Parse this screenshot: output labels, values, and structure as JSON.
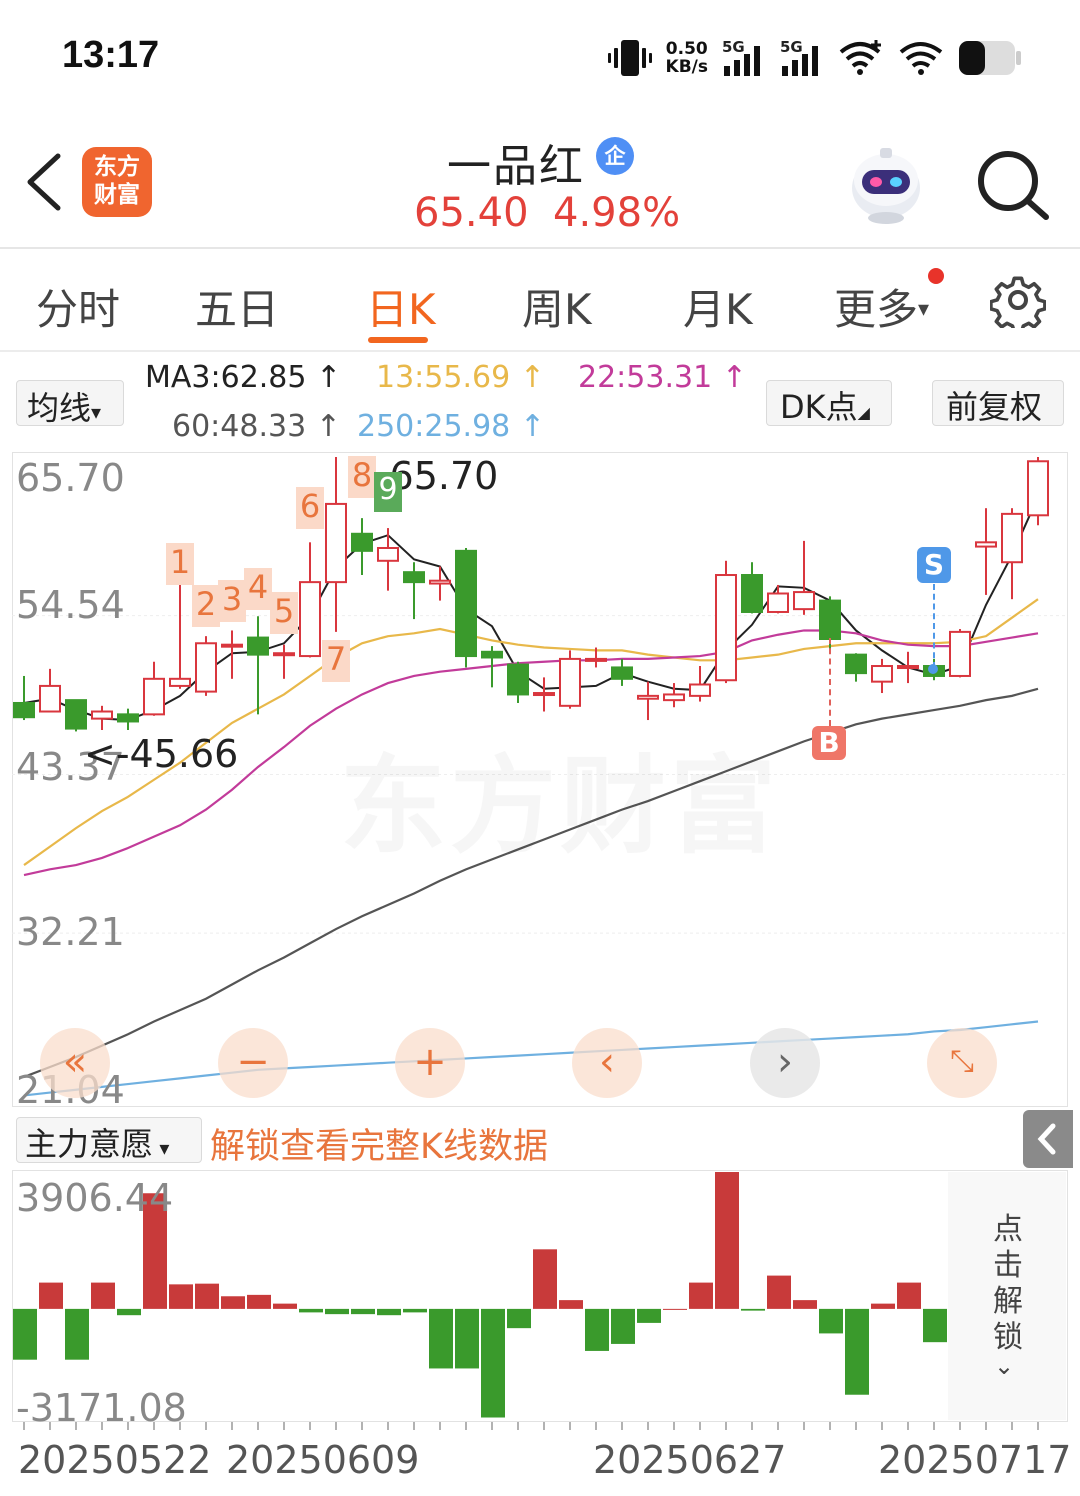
{
  "status_bar": {
    "time": "13:17",
    "net_speed_value": "0.50",
    "net_speed_unit": "KB/s",
    "sim1_label": "5G",
    "sim2_label": "5G",
    "icons": [
      "vibrate-icon",
      "signal-icon",
      "signal-icon",
      "wifi-plus-icon",
      "wifi-icon",
      "battery-icon"
    ],
    "battery_level": 0.35
  },
  "header": {
    "app_logo_line1": "东方",
    "app_logo_line2": "财富",
    "stock_name": "一品红",
    "stock_badge": "企",
    "price": "65.40",
    "change_pct": "4.98%",
    "price_color": "#e3413a"
  },
  "tabs": [
    {
      "label": "分时"
    },
    {
      "label": "五日"
    },
    {
      "label": "日K",
      "active": true
    },
    {
      "label": "周K"
    },
    {
      "label": "月K"
    },
    {
      "label": "更多"
    }
  ],
  "ma_row": {
    "selector": "均线",
    "ma3": "MA3:62.85",
    "ma13": "13:55.69",
    "ma22": "22:53.31",
    "ma60": "60:48.33",
    "ma250": "250:25.98",
    "arrow": "↑",
    "dk_button": "DK点",
    "adjust_button": "前复权",
    "colors": {
      "ma3": "#222222",
      "ma13": "#e8b84a",
      "ma22": "#c23b9a",
      "ma60": "#555555",
      "ma250": "#6fb0e0"
    }
  },
  "main_chart": {
    "y_labels": [
      "65.70",
      "54.54",
      "43.37",
      "32.21",
      "21.04"
    ],
    "max_marker": "<-65.70",
    "min_marker": "<-45.66",
    "watermark": "东方财富",
    "sequence_marks": [
      "1",
      "2",
      "3",
      "4",
      "5",
      "6",
      "7",
      "8",
      "9"
    ],
    "signal_s": "S",
    "signal_b": "B",
    "controls": [
      "double-left-icon",
      "zoom-out-icon",
      "zoom-in-icon",
      "prev-icon",
      "next-icon",
      "fullscreen-icon"
    ]
  },
  "chart_data": {
    "type": "candlestick",
    "ylim": [
      21.04,
      65.7
    ],
    "candles": [
      {
        "o": 48.4,
        "c": 47.4,
        "h": 50.3,
        "l": 47.2
      },
      {
        "o": 47.8,
        "c": 49.6,
        "h": 50.8,
        "l": 47.8
      },
      {
        "o": 48.6,
        "c": 46.6,
        "h": 48.6,
        "l": 46.4
      },
      {
        "o": 47.3,
        "c": 47.8,
        "h": 48.2,
        "l": 46.5
      },
      {
        "o": 47.6,
        "c": 47.1,
        "h": 48.0,
        "l": 46.5
      },
      {
        "o": 47.6,
        "c": 50.1,
        "h": 51.3,
        "l": 47.5
      },
      {
        "o": 49.6,
        "c": 50.1,
        "h": 57.4,
        "l": 49.4
      },
      {
        "o": 49.2,
        "c": 52.6,
        "h": 53.1,
        "l": 48.9
      },
      {
        "o": 52.5,
        "c": 52.5,
        "h": 53.5,
        "l": 50.1
      },
      {
        "o": 53.0,
        "c": 51.8,
        "h": 54.5,
        "l": 47.6
      },
      {
        "o": 51.9,
        "c": 51.9,
        "h": 52.5,
        "l": 50.1
      },
      {
        "o": 51.7,
        "c": 56.9,
        "h": 59.7,
        "l": 51.6
      },
      {
        "o": 56.9,
        "c": 62.4,
        "h": 65.7,
        "l": 53.4
      },
      {
        "o": 60.3,
        "c": 59.1,
        "h": 61.4,
        "l": 57.4
      },
      {
        "o": 58.4,
        "c": 59.3,
        "h": 60.7,
        "l": 56.3
      },
      {
        "o": 57.6,
        "c": 56.9,
        "h": 58.3,
        "l": 54.3
      },
      {
        "o": 56.8,
        "c": 57.0,
        "h": 58.0,
        "l": 55.6
      },
      {
        "o": 59.1,
        "c": 51.7,
        "h": 59.3,
        "l": 50.9
      },
      {
        "o": 52.0,
        "c": 51.6,
        "h": 52.4,
        "l": 49.5
      },
      {
        "o": 51.1,
        "c": 49.0,
        "h": 51.3,
        "l": 48.4
      },
      {
        "o": 49.1,
        "c": 49.1,
        "h": 50.2,
        "l": 47.8
      },
      {
        "o": 48.2,
        "c": 51.5,
        "h": 52.1,
        "l": 48.0
      },
      {
        "o": 51.5,
        "c": 51.5,
        "h": 52.3,
        "l": 50.9
      },
      {
        "o": 50.9,
        "c": 50.1,
        "h": 51.5,
        "l": 49.6
      },
      {
        "o": 48.7,
        "c": 48.9,
        "h": 49.9,
        "l": 47.2
      },
      {
        "o": 48.6,
        "c": 49.0,
        "h": 49.8,
        "l": 48.1
      },
      {
        "o": 48.9,
        "c": 49.7,
        "h": 51.0,
        "l": 48.5
      },
      {
        "o": 50.0,
        "c": 57.4,
        "h": 58.4,
        "l": 49.8
      },
      {
        "o": 57.4,
        "c": 54.8,
        "h": 58.3,
        "l": 54.7
      },
      {
        "o": 54.8,
        "c": 56.1,
        "h": 56.7,
        "l": 54.7
      },
      {
        "o": 55.0,
        "c": 56.2,
        "h": 59.8,
        "l": 54.6
      },
      {
        "o": 55.6,
        "c": 52.9,
        "h": 55.9,
        "l": 52.0
      },
      {
        "o": 51.8,
        "c": 50.5,
        "h": 51.9,
        "l": 49.9
      },
      {
        "o": 49.9,
        "c": 51.0,
        "h": 51.5,
        "l": 49.1
      },
      {
        "o": 51.0,
        "c": 51.0,
        "h": 52.0,
        "l": 49.8
      },
      {
        "o": 51.0,
        "c": 50.3,
        "h": 51.5,
        "l": 50.0
      },
      {
        "o": 50.3,
        "c": 53.4,
        "h": 53.6,
        "l": 50.2
      },
      {
        "o": 59.4,
        "c": 59.7,
        "h": 62.1,
        "l": 56.0
      },
      {
        "o": 58.3,
        "c": 61.7,
        "h": 62.1,
        "l": 55.7
      },
      {
        "o": 61.6,
        "c": 65.4,
        "h": 65.7,
        "l": 60.9
      }
    ],
    "series": [
      {
        "name": "MA3",
        "values": [
          48.4,
          48.7,
          47.9,
          47.3,
          47.2,
          47.9,
          48.9,
          50.6,
          51.9,
          52.0,
          52.6,
          54.5,
          57.9,
          59.6,
          60.2,
          58.5,
          58.0,
          55.0,
          53.8,
          50.6,
          49.4,
          49.5,
          49.6,
          50.5,
          49.9,
          49.4,
          49.3,
          52.1,
          53.9,
          56.6,
          56.5,
          55.6,
          53.5,
          52.1,
          50.9,
          50.4,
          51.0,
          55.3,
          58.8,
          62.9
        ]
      },
      {
        "name": "MA13",
        "values": [
          37.0,
          38.3,
          39.6,
          40.8,
          41.8,
          43.0,
          44.2,
          45.6,
          47.0,
          48.0,
          49.0,
          50.3,
          51.6,
          52.6,
          53.1,
          53.3,
          53.6,
          53.2,
          52.8,
          52.5,
          52.3,
          52.2,
          52.1,
          52.1,
          51.8,
          51.6,
          51.4,
          51.4,
          51.6,
          51.8,
          52.2,
          52.4,
          52.6,
          52.6,
          52.6,
          52.6,
          52.7,
          53.1,
          54.4,
          55.7
        ]
      },
      {
        "name": "MA22",
        "values": [
          36.3,
          36.7,
          37.0,
          37.5,
          38.2,
          39.0,
          39.8,
          40.9,
          42.3,
          43.9,
          45.3,
          46.8,
          48.0,
          49.0,
          49.8,
          50.3,
          50.6,
          50.8,
          51.0,
          51.2,
          51.3,
          51.4,
          51.4,
          51.5,
          51.5,
          51.6,
          51.7,
          52.0,
          52.8,
          53.2,
          53.5,
          53.5,
          53.3,
          52.8,
          52.5,
          52.4,
          52.4,
          52.7,
          53.0,
          53.3
        ]
      },
      {
        "name": "MA60",
        "values": [
          22.1,
          22.8,
          23.5,
          24.3,
          25.1,
          26.0,
          26.8,
          27.6,
          28.6,
          29.6,
          30.5,
          31.5,
          32.5,
          33.4,
          34.2,
          35.0,
          35.9,
          36.7,
          37.4,
          38.1,
          38.8,
          39.5,
          40.2,
          40.9,
          41.5,
          42.2,
          42.9,
          43.6,
          44.3,
          45.0,
          45.7,
          46.3,
          46.9,
          47.3,
          47.6,
          47.9,
          48.2,
          48.6,
          48.9,
          49.4
        ]
      },
      {
        "name": "MA250",
        "values": [
          20.8,
          21.0,
          21.2,
          21.4,
          21.6,
          21.8,
          22.0,
          22.2,
          22.4,
          22.6,
          22.7,
          22.8,
          22.9,
          23.0,
          23.1,
          23.2,
          23.3,
          23.4,
          23.5,
          23.6,
          23.7,
          23.8,
          23.9,
          24.0,
          24.1,
          24.2,
          24.3,
          24.4,
          24.5,
          24.6,
          24.7,
          24.8,
          24.9,
          25.0,
          25.1,
          25.3,
          25.4,
          25.6,
          25.8,
          26.0
        ]
      }
    ],
    "max_label": "65.70",
    "min_label": "45.66",
    "indicator": {
      "name": "主力意愿",
      "ylim": [
        -3171.08,
        3906.44
      ],
      "values": [
        -1450,
        750,
        -1450,
        750,
        -180,
        3300,
        700,
        720,
        360,
        400,
        150,
        -100,
        -150,
        -150,
        -180,
        -100,
        -1700,
        -1700,
        -3100,
        -550,
        1700,
        250,
        -1200,
        -1000,
        -400,
        0,
        750,
        3906,
        -50,
        950,
        250,
        -700,
        -2450,
        150,
        750,
        -950
      ]
    }
  },
  "indicator_bar": {
    "selector": "主力意愿",
    "unlock_text": "解锁查看完整K线数据",
    "y_max": "3906.44",
    "y_min": "-3171.08",
    "side_unlock": "点击解锁"
  },
  "dates": [
    "20250522",
    "20250609",
    "20250627",
    "20250717"
  ],
  "colors": {
    "up": "#d9363e",
    "down": "#3a9a2c",
    "accent": "#f2661f"
  }
}
